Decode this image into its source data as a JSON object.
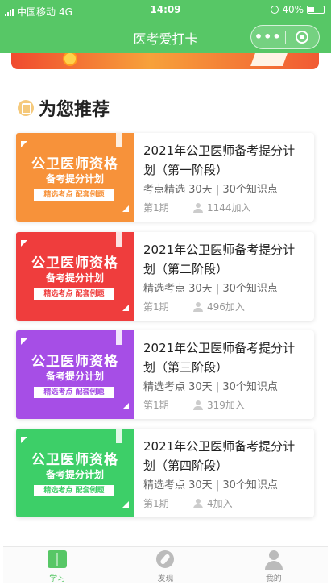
{
  "status_bar": {
    "carrier": "中国移动",
    "network": "4G",
    "time": "14:09",
    "battery": "40%"
  },
  "nav": {
    "title": "医考爱打卡",
    "more_label": "•••"
  },
  "section": {
    "title": "为您推荐"
  },
  "colors": {
    "brand": "#57c766",
    "card_orange": "#f7923a",
    "card_red": "#ef3d3d",
    "card_purple": "#a64ee6",
    "card_green": "#3dcf68"
  },
  "courses": [
    {
      "thumb_title": "公卫医师资格",
      "thumb_subtitle": "备考提分计划",
      "thumb_tag": "精选考点 配套例题",
      "title": "2021年公卫医师备考提分计划（第一阶段）",
      "meta": "考点精选  30天 | 30个知识点",
      "period": "第1期",
      "joined": "1144加入"
    },
    {
      "thumb_title": "公卫医师资格",
      "thumb_subtitle": "备考提分计划",
      "thumb_tag": "精选考点 配套例题",
      "title": "2021年公卫医师备考提分计划（第二阶段）",
      "meta": "精选考点  30天 | 30个知识点",
      "period": "第1期",
      "joined": "496加入"
    },
    {
      "thumb_title": "公卫医师资格",
      "thumb_subtitle": "备考提分计划",
      "thumb_tag": "精选考点 配套例题",
      "title": "2021年公卫医师备考提分计划（第三阶段）",
      "meta": "精选考点  30天 | 30个知识点",
      "period": "第1期",
      "joined": "319加入"
    },
    {
      "thumb_title": "公卫医师资格",
      "thumb_subtitle": "备考提分计划",
      "thumb_tag": "精选考点 配套例题",
      "title": "2021年公卫医师备考提分计划（第四阶段）",
      "meta": "精选考点  30天 | 30个知识点",
      "period": "第1期",
      "joined": "4加入"
    }
  ],
  "tabs": [
    {
      "label": "学习",
      "icon": "book-icon",
      "active": true
    },
    {
      "label": "发现",
      "icon": "compass-icon",
      "active": false
    },
    {
      "label": "我的",
      "icon": "user-icon",
      "active": false
    }
  ]
}
